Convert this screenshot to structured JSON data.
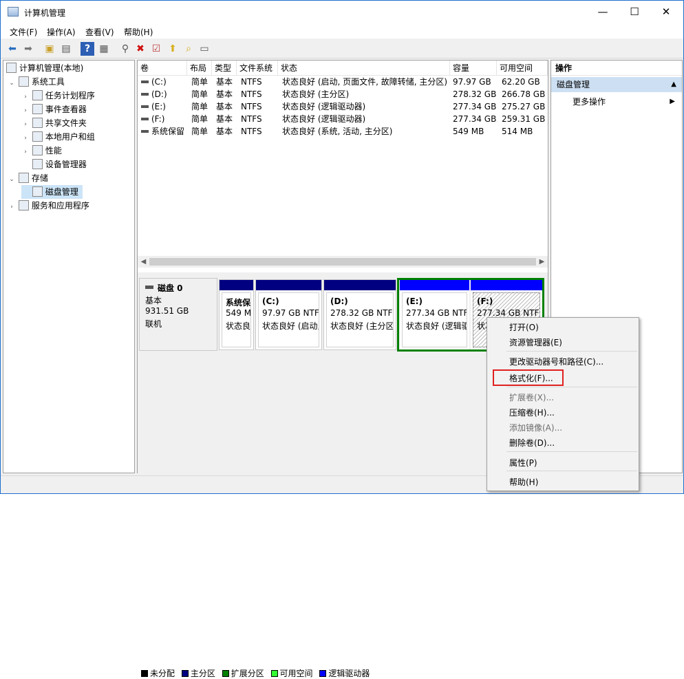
{
  "window": {
    "title": "计算机管理",
    "minimize": "—",
    "maximize": "☐",
    "close": "✕"
  },
  "menu": [
    "文件(F)",
    "操作(A)",
    "查看(V)",
    "帮助(H)"
  ],
  "toolbar_icons": [
    "back-arrow-icon",
    "forward-arrow-icon",
    "up-folder-icon",
    "show-tree-icon",
    "help-icon",
    "view-icon",
    "connect-icon",
    "delete-icon",
    "checklist-icon",
    "import-icon",
    "search-folder-icon",
    "properties-icon"
  ],
  "tree": [
    {
      "label": "计算机管理(本地)",
      "arrow": "",
      "level": 0
    },
    {
      "label": "系统工具",
      "arrow": "⌄",
      "level": 1
    },
    {
      "label": "任务计划程序",
      "arrow": "›",
      "level": 2
    },
    {
      "label": "事件查看器",
      "arrow": "›",
      "level": 2
    },
    {
      "label": "共享文件夹",
      "arrow": "›",
      "level": 2
    },
    {
      "label": "本地用户和组",
      "arrow": "›",
      "level": 2
    },
    {
      "label": "性能",
      "arrow": "›",
      "level": 2
    },
    {
      "label": "设备管理器",
      "arrow": "",
      "level": 2
    },
    {
      "label": "存储",
      "arrow": "⌄",
      "level": 1
    },
    {
      "label": "磁盘管理",
      "arrow": "",
      "level": 2,
      "selected": true
    },
    {
      "label": "服务和应用程序",
      "arrow": "›",
      "level": 1
    }
  ],
  "volume_columns": [
    "卷",
    "布局",
    "类型",
    "文件系统",
    "状态",
    "容量",
    "可用空间"
  ],
  "volumes": [
    [
      "(C:)",
      "简单",
      "基本",
      "NTFS",
      "状态良好 (启动, 页面文件, 故障转储, 主分区)",
      "97.97 GB",
      "62.20 GB"
    ],
    [
      "(D:)",
      "简单",
      "基本",
      "NTFS",
      "状态良好 (主分区)",
      "278.32 GB",
      "266.78 GB"
    ],
    [
      "(E:)",
      "简单",
      "基本",
      "NTFS",
      "状态良好 (逻辑驱动器)",
      "277.34 GB",
      "275.27 GB"
    ],
    [
      "(F:)",
      "简单",
      "基本",
      "NTFS",
      "状态良好 (逻辑驱动器)",
      "277.34 GB",
      "259.31 GB"
    ],
    [
      "系统保留",
      "简单",
      "基本",
      "NTFS",
      "状态良好 (系统, 活动, 主分区)",
      "549 MB",
      "514 MB"
    ]
  ],
  "disk": {
    "name": "磁盘 0",
    "type": "基本",
    "size": "931.51 GB",
    "status": "联机"
  },
  "partitions": [
    {
      "name": "系统保留",
      "size": "549 M",
      "status": "状态良"
    },
    {
      "name": "(C:)",
      "size": "97.97 GB NTFS",
      "status": "状态良好 (启动,"
    },
    {
      "name": "(D:)",
      "size": "278.32 GB NTFS",
      "status": "状态良好 (主分区"
    },
    {
      "name": "(E:)",
      "size": "277.34 GB NTF",
      "status": "状态良好 (逻辑驱"
    },
    {
      "name": "(F:)",
      "size": "277.34 GB NTF",
      "status": "状况"
    }
  ],
  "legend": [
    {
      "label": "未分配",
      "color": "#000000"
    },
    {
      "label": "主分区",
      "color": "#000080"
    },
    {
      "label": "扩展分区",
      "color": "#008000"
    },
    {
      "label": "可用空间",
      "color": "#33ff33"
    },
    {
      "label": "逻辑驱动器",
      "color": "#0000ff"
    }
  ],
  "actions": {
    "header": "操作",
    "section": "磁盘管理",
    "more": "更多操作"
  },
  "context_menu": [
    {
      "label": "打开(O)",
      "disabled": false
    },
    {
      "label": "资源管理器(E)",
      "disabled": false
    },
    {
      "label": "更改驱动器号和路径(C)...",
      "disabled": false
    },
    {
      "label": "格式化(F)...",
      "disabled": false,
      "highlighted": true
    },
    {
      "label": "扩展卷(X)...",
      "disabled": true
    },
    {
      "label": "压缩卷(H)...",
      "disabled": false
    },
    {
      "label": "添加镜像(A)...",
      "disabled": true
    },
    {
      "label": "删除卷(D)...",
      "disabled": false
    },
    {
      "label": "属性(P)",
      "disabled": false
    },
    {
      "label": "帮助(H)",
      "disabled": false
    }
  ],
  "colors": {
    "primary": "#000080",
    "logical": "#0000ff",
    "extended": "#008000",
    "selection": "#cce4f7",
    "highlight_box": "#e02020"
  }
}
